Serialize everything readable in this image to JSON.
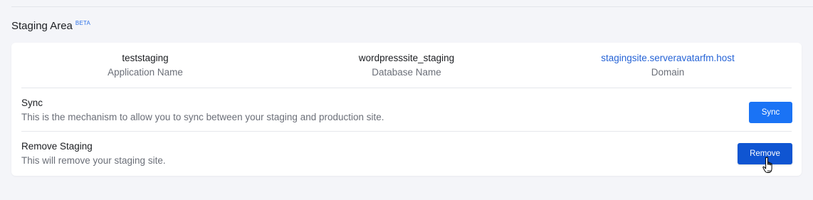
{
  "section": {
    "title": "Staging Area",
    "badge": "BETA"
  },
  "info": {
    "application_name": {
      "value": "teststaging",
      "label": "Application Name"
    },
    "database_name": {
      "value": "wordpresssite_staging",
      "label": "Database Name"
    },
    "domain": {
      "value": "stagingsite.serveravatarfm.host",
      "label": "Domain"
    }
  },
  "sync": {
    "title": "Sync",
    "description": "This is the mechanism to allow you to sync between your staging and production site.",
    "button_label": "Sync"
  },
  "remove": {
    "title": "Remove Staging",
    "description": "This will remove your staging site.",
    "button_label": "Remove"
  },
  "colors": {
    "link": "#2563d6",
    "sync_button": "#1a73f5",
    "remove_button": "#0f55d2"
  },
  "icons": {
    "cursor": "hand-pointer-icon"
  }
}
